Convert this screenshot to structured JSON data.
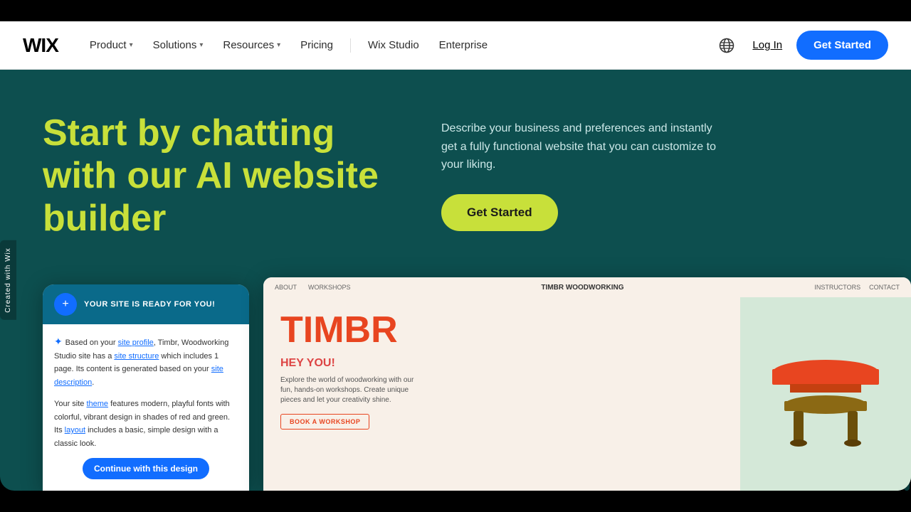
{
  "topBar": {},
  "navbar": {
    "logo": "WIX",
    "navItems": [
      {
        "label": "Product",
        "hasDropdown": true
      },
      {
        "label": "Solutions",
        "hasDropdown": true
      },
      {
        "label": "Resources",
        "hasDropdown": true
      },
      {
        "label": "Pricing",
        "hasDropdown": false
      },
      {
        "label": "Wix Studio",
        "hasDropdown": false
      },
      {
        "label": "Enterprise",
        "hasDropdown": false
      }
    ],
    "loginLabel": "Log In",
    "getStartedLabel": "Get Started"
  },
  "hero": {
    "title": "Start by chatting with our AI website builder",
    "description": "Describe your business and preferences and instantly get a fully functional website that you can customize to your liking.",
    "getStartedLabel": "Get Started",
    "backgroundColor": "#0d4f4f",
    "titleColor": "#c8e03a"
  },
  "chatCard": {
    "headerText": "YOUR SITE IS READY FOR YOU!",
    "iconSymbol": "+",
    "messages": [
      {
        "text": "Based on your site profile, Timbr, Woodworking Studio site has a site structure which includes 1 page. Its content is generated based on your site description."
      },
      {
        "text": "Your site theme features modern, playful fonts with colorful, vibrant design in shades of red and green. Its layout includes a basic, simple design with a classic look."
      }
    ],
    "continueLabel": "Continue with this design"
  },
  "previewCard": {
    "navLinks": [
      "ABOUT",
      "WORKSHOPS"
    ],
    "brand": "TIMBR WOODWORKING",
    "navRight": [
      "INSTRUCTORS",
      "CONTACT"
    ],
    "brandLarge": "TIMBR",
    "heyText": "HEY YOU!",
    "description": "Explore the world of woodworking with our fun, hands-on workshops. Create unique pieces and let your creativity shine.",
    "bookLabel": "BOOK A WORKSHOP"
  },
  "sideTab": {
    "text": "Created with Wix"
  }
}
